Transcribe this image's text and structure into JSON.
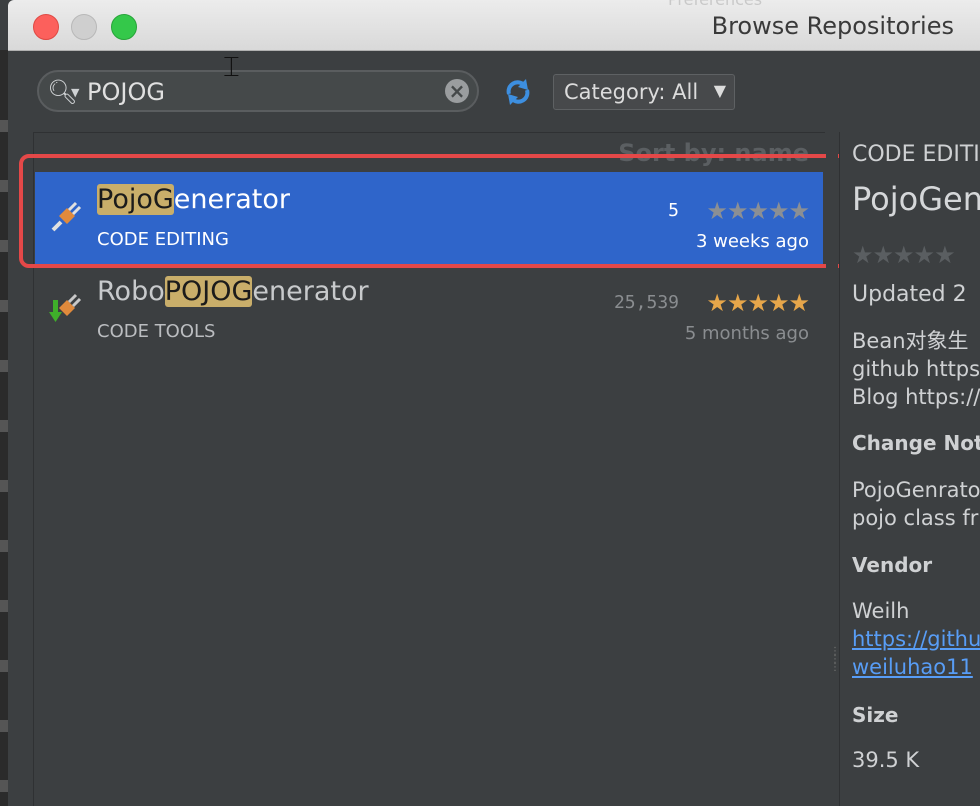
{
  "window": {
    "title": "Browse Repositories",
    "ghost_title": "Preferences"
  },
  "search": {
    "value": "POJOG"
  },
  "category": {
    "label": "Category: All"
  },
  "list": {
    "sort_label": "Sort by: name",
    "plugins": [
      {
        "name_highlight": "PojoG",
        "name_rest": "enerator",
        "category": "CODE EDITING",
        "downloads": "5",
        "rating_stars": 0,
        "updated": "3 weeks ago",
        "selected": true
      },
      {
        "name_prefix": "Robo",
        "name_highlight": "POJOG",
        "name_rest": "enerator",
        "category": "CODE TOOLS",
        "downloads": "25,539",
        "rating_stars": 5,
        "updated": "5 months ago",
        "selected": false
      }
    ]
  },
  "details": {
    "category": "CODE EDITI",
    "name": "PojoGen",
    "updated": "Updated 2",
    "desc_line1": "Bean对象生",
    "desc_line2": "github https",
    "desc_line3": "Blog https://",
    "change_notes_heading": "Change Note",
    "notes_line1": "PojoGenrato",
    "notes_line2": "pojo class fr",
    "vendor_heading": "Vendor",
    "vendor_name": "Weilh",
    "vendor_link1": "https://githul",
    "vendor_link2": "weiluhao11",
    "size_heading": "Size",
    "size_value": "39.5 K"
  },
  "colors": {
    "selection": "#2f65ca",
    "highlight": "#c9ae6a",
    "annotation_box": "#e44848",
    "star_filled": "#e6a64a",
    "link": "#589df6"
  }
}
